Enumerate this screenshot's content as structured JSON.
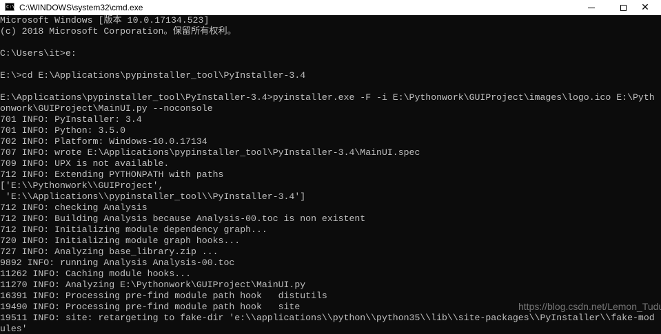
{
  "window": {
    "title": "C:\\WINDOWS\\system32\\cmd.exe",
    "icon": "cmd-icon",
    "icon_text": "C:\\"
  },
  "controls": {
    "minimize_icon": "minimize-icon",
    "maximize_icon": "maximize-icon",
    "close_glyph": "✕"
  },
  "colors": {
    "console_background": "#0c0c0c",
    "console_text": "#c0c0c0",
    "titlebar_background": "#ffffff"
  },
  "console": {
    "lines": [
      "Microsoft Windows [版本 10.0.17134.523]",
      "(c) 2018 Microsoft Corporation。保留所有权利。",
      "",
      "C:\\Users\\it>e:",
      "",
      "E:\\>cd E:\\Applications\\pypinstaller_tool\\PyInstaller-3.4",
      "",
      "E:\\Applications\\pypinstaller_tool\\PyInstaller-3.4>pyinstaller.exe -F -i E:\\Pythonwork\\GUIProject\\images\\logo.ico E:\\Pyth",
      "onwork\\GUIProject\\MainUI.py --noconsole",
      "701 INFO: PyInstaller: 3.4",
      "701 INFO: Python: 3.5.0",
      "702 INFO: Platform: Windows-10.0.17134",
      "707 INFO: wrote E:\\Applications\\pypinstaller_tool\\PyInstaller-3.4\\MainUI.spec",
      "709 INFO: UPX is not available.",
      "712 INFO: Extending PYTHONPATH with paths",
      "['E:\\\\Pythonwork\\\\GUIProject',",
      " 'E:\\\\Applications\\\\pypinstaller_tool\\\\PyInstaller-3.4']",
      "712 INFO: checking Analysis",
      "712 INFO: Building Analysis because Analysis-00.toc is non existent",
      "712 INFO: Initializing module dependency graph...",
      "720 INFO: Initializing module graph hooks...",
      "727 INFO: Analyzing base_library.zip ...",
      "9892 INFO: running Analysis Analysis-00.toc",
      "11262 INFO: Caching module hooks...",
      "11270 INFO: Analyzing E:\\Pythonwork\\GUIProject\\MainUI.py",
      "16391 INFO: Processing pre-find module path hook   distutils",
      "19490 INFO: Processing pre-find module path hook   site",
      "19511 INFO: site: retargeting to fake-dir 'e:\\\\applications\\\\python\\\\python35\\\\lib\\\\site-packages\\\\PyInstaller\\\\fake-mod",
      "ules'"
    ],
    "watermark": "https://blog.csdn.net/Lemon_Tudu"
  }
}
